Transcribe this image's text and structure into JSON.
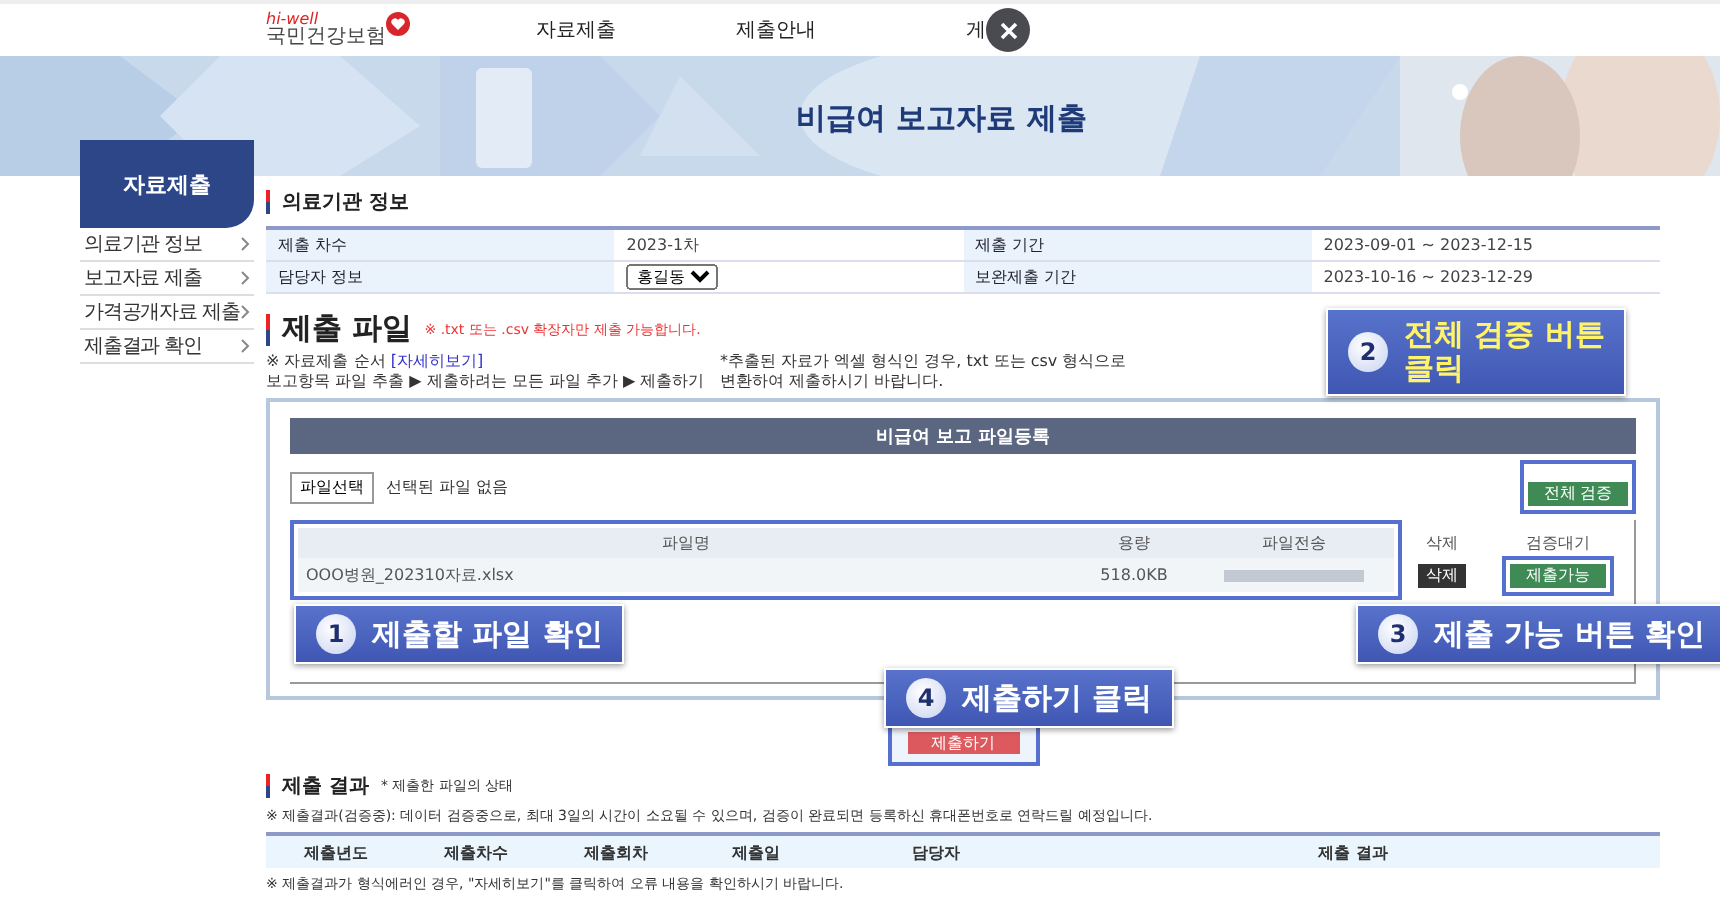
{
  "nav": {
    "logo_tagline": "hi-well",
    "logo_name": "국민건강보험",
    "items": [
      {
        "label": "자료제출"
      },
      {
        "label": "제출안내"
      },
      {
        "label": "게"
      }
    ]
  },
  "banner": {
    "title": "비급여 보고자료 제출"
  },
  "sidebar": {
    "title": "자료제출",
    "items": [
      {
        "label": "의료기관 정보"
      },
      {
        "label": "보고자료 제출"
      },
      {
        "label": "가격공개자료 제출"
      },
      {
        "label": "제출결과 확인"
      }
    ]
  },
  "institution": {
    "heading": "의료기관 정보",
    "rows": [
      [
        {
          "kind": "label",
          "text": "제출 차수"
        },
        {
          "kind": "text",
          "text": "2023-1차"
        },
        {
          "kind": "label",
          "text": "제출 기간"
        },
        {
          "kind": "text",
          "text": "2023-09-01 ~ 2023-12-15"
        }
      ],
      [
        {
          "kind": "label",
          "text": "담당자 정보"
        },
        {
          "kind": "select",
          "text": "홍길동"
        },
        {
          "kind": "label",
          "text": "보완제출 기간"
        },
        {
          "kind": "text",
          "text": "2023-10-16 ~ 2023-12-29"
        }
      ]
    ]
  },
  "submission": {
    "heading": "제출 파일",
    "note": "※ .txt 또는 .csv 확장자만 제출 가능합니다.",
    "order_prefix": "※ 자료제출 순서",
    "order_link": "[자세히보기]",
    "order_steps": "보고항목 파일 추출 ▶ 제출하려는 모든 파일 추가 ▶ 제출하기",
    "hint_lines": [
      "*추출된 자료가 엑셀 형식인 경우, txt 또는 csv 형식으로",
      "변환하여 제출하시기 바랍니다."
    ]
  },
  "upload": {
    "title": "비급여 보고 파일등록",
    "choose_button": "파일선택",
    "no_file": "선택된 파일 없음",
    "verify_all_button": "전체 검증",
    "columns": [
      "파일명",
      "용량",
      "파일전송",
      "삭제",
      "검증대기"
    ],
    "rows": [
      {
        "file": "OOO병원_202310자료.xlsx",
        "size": "518.0KB",
        "level": 1,
        "delete": "삭제",
        "status": "제출가능"
      }
    ]
  },
  "submit_button": "제출하기",
  "callouts": [
    {
      "number": "1",
      "lines": [
        "제출할 파일 확인"
      ],
      "emphasis": false
    },
    {
      "number": "2",
      "lines": [
        "전체 검증 버튼",
        "클릭"
      ],
      "emphasis": true
    },
    {
      "number": "3",
      "lines": [
        "제출 가능 버튼 확인"
      ],
      "emphasis": false
    },
    {
      "number": "4",
      "lines": [
        "제출하기 클릭"
      ],
      "emphasis": false
    }
  ],
  "results": {
    "heading": "제출 결과",
    "subnote": "* 제출한 파일의 상태",
    "notice": "※ 제출결과(검증중): 데이터 검증중으로, 최대 3일의 시간이 소요될 수 있으며, 검증이 완료되면 등록하신 휴대폰번호로 연락드릴 예정입니다.",
    "columns": [
      "제출년도",
      "제출차수",
      "제출회차",
      "제출일",
      "담당자",
      "제출 결과"
    ],
    "footnote": "※ 제출결과가 형식에러인 경우, \"자세히보기\"를 클릭하여 오류 내용을 확인하시기 바랍니다."
  }
}
